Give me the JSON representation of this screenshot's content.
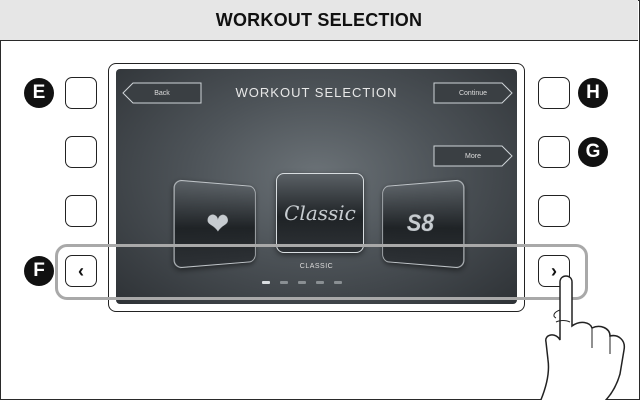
{
  "header": {
    "title": "WORKOUT SELECTION"
  },
  "callouts": {
    "e": "E",
    "f": "F",
    "g": "G",
    "h": "H"
  },
  "screen": {
    "title": "WORKOUT SELECTION",
    "back_label": "Back",
    "continue_label": "Continue",
    "more_label": "More",
    "cards": [
      {
        "label": "",
        "icon": "heart-icon"
      },
      {
        "label": "Classic",
        "icon": "classic-icon"
      },
      {
        "label": "S8",
        "icon": "s8-icon"
      }
    ],
    "selected_caption": "CLASSIC",
    "page_count": 5,
    "active_page": 1
  },
  "side_buttons": {
    "left_arrow": "‹",
    "right_arrow": "›"
  },
  "colors": {
    "accent_highlight": "#a9a9a9",
    "screen_bg": "#4d5358"
  }
}
